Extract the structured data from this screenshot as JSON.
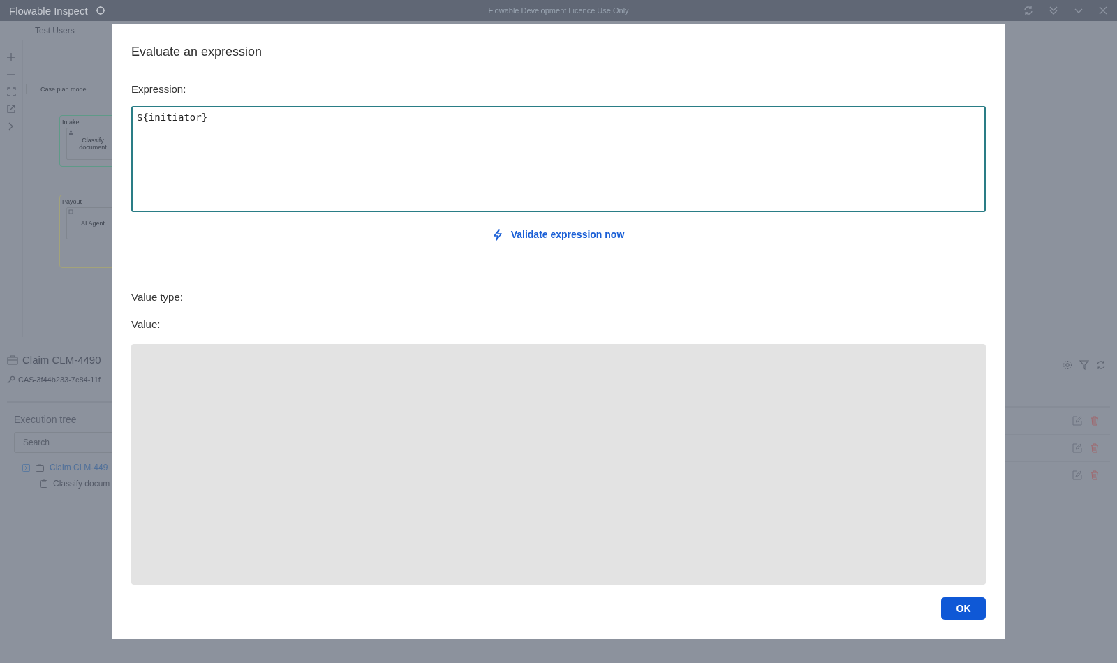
{
  "app": {
    "title": "Flowable Inspect",
    "licence": "Flowable Development Licence Use Only",
    "tab": "Test Users"
  },
  "diagram": {
    "plan_model": "Case plan model",
    "stages": [
      {
        "name": "Intake",
        "color": "#5f9a88",
        "task": "Classify document"
      },
      {
        "name": "Payout",
        "color": "#a3a37a",
        "task": "AI Agent"
      }
    ]
  },
  "case": {
    "name": "Claim CLM-4490",
    "id": "CAS-3f44b233-7c84-11f"
  },
  "execution_tree": {
    "title": "Execution tree",
    "search_placeholder": "Search",
    "items": [
      {
        "label": "Claim CLM-449",
        "kind": "case",
        "children": [
          {
            "label": "Classify docum",
            "kind": "task"
          }
        ]
      }
    ]
  },
  "dialog": {
    "title": "Evaluate an expression",
    "expression_label": "Expression:",
    "expression": "${initiator}",
    "validate_link": "Validate expression now",
    "value_type_label": "Value type:",
    "value_label": "Value:",
    "ok_button": "OK"
  }
}
